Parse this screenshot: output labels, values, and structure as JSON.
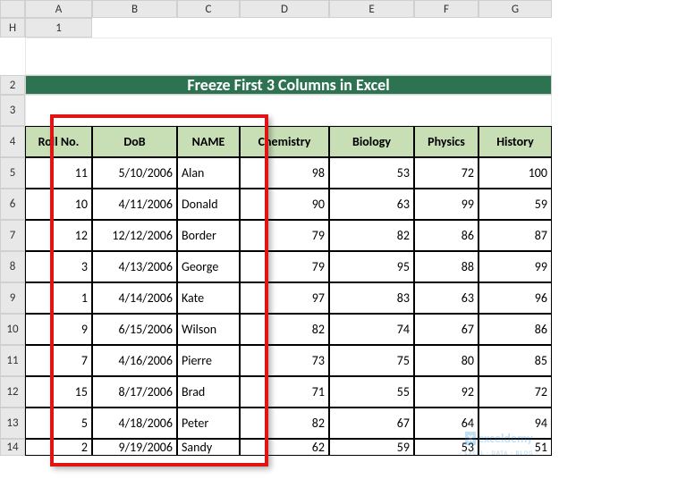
{
  "columns": [
    "",
    "A",
    "B",
    "C",
    "D",
    "E",
    "F",
    "G",
    "H"
  ],
  "rows": [
    "1",
    "2",
    "3",
    "4",
    "5",
    "6",
    "7",
    "8",
    "9",
    "10",
    "11",
    "12",
    "13",
    "14"
  ],
  "title": "Freeze First 3 Columns in Excel",
  "headers": [
    "Roll No.",
    "DoB",
    "NAME",
    "Chemistry",
    "Biology",
    "Physics",
    "History"
  ],
  "data": [
    {
      "roll": "11",
      "dob": "5/10/2006",
      "name": "Alan",
      "chem": "98",
      "bio": "53",
      "phy": "72",
      "hist": "100"
    },
    {
      "roll": "10",
      "dob": "4/11/2006",
      "name": "Donald",
      "chem": "90",
      "bio": "63",
      "phy": "99",
      "hist": "59"
    },
    {
      "roll": "12",
      "dob": "12/12/2006",
      "name": "Border",
      "chem": "79",
      "bio": "82",
      "phy": "86",
      "hist": "87"
    },
    {
      "roll": "3",
      "dob": "4/13/2006",
      "name": "George",
      "chem": "79",
      "bio": "95",
      "phy": "88",
      "hist": "99"
    },
    {
      "roll": "1",
      "dob": "4/14/2006",
      "name": "Kate",
      "chem": "97",
      "bio": "83",
      "phy": "63",
      "hist": "96"
    },
    {
      "roll": "9",
      "dob": "6/15/2006",
      "name": "Wilson",
      "chem": "82",
      "bio": "74",
      "phy": "67",
      "hist": "86"
    },
    {
      "roll": "7",
      "dob": "4/16/2006",
      "name": "Pierre",
      "chem": "73",
      "bio": "75",
      "phy": "80",
      "hist": "85"
    },
    {
      "roll": "15",
      "dob": "8/17/2006",
      "name": "Brad",
      "chem": "71",
      "bio": "55",
      "phy": "92",
      "hist": "72"
    },
    {
      "roll": "5",
      "dob": "4/18/2006",
      "name": "Peter",
      "chem": "82",
      "bio": "67",
      "phy": "64",
      "hist": "94"
    },
    {
      "roll": "2",
      "dob": "9/19/2006",
      "name": "Sandy",
      "chem": "62",
      "bio": "59",
      "phy": "53",
      "hist": "51"
    }
  ],
  "watermark": {
    "brand": "exceldemy",
    "tagline": "· EXCEL · DATA · BLOG ·"
  }
}
